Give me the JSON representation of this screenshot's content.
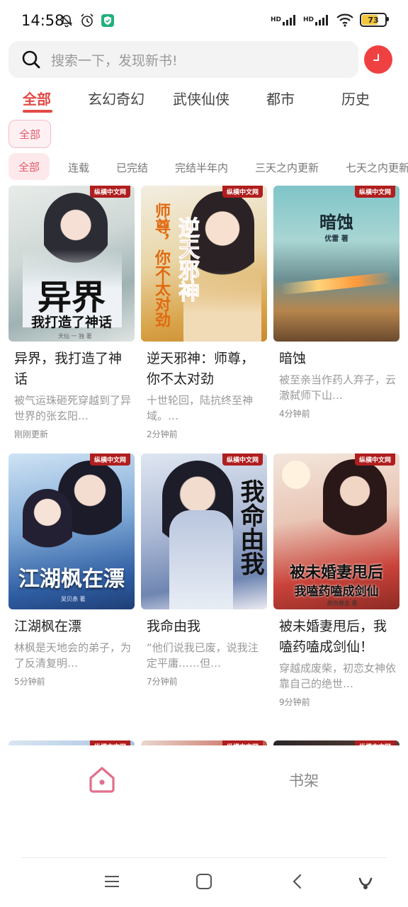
{
  "status_bar": {
    "time": "14:58",
    "battery": "73",
    "hd_label_1": "HD",
    "hd_label_2": "HD"
  },
  "search": {
    "placeholder": "搜索一下，发现新书!"
  },
  "category_tabs": [
    "全部",
    "玄幻奇幻",
    "武侠仙侠",
    "都市",
    "历史"
  ],
  "subcategory_chip": "全部",
  "filter_tabs": [
    "全部",
    "连载",
    "已完结",
    "完结半年内",
    "三天之内更新",
    "七天之内更新"
  ],
  "books": [
    {
      "title": "异界，我打造了神话",
      "desc": "被气运珠砸死穿越到了异世界的张玄阳…",
      "time": "刚刚更新",
      "cover_big": "异界",
      "cover_sub": "我打造了神话",
      "cover_author": "天仙 一 独 著"
    },
    {
      "title": "逆天邪神：师尊，你不太对劲",
      "desc": "十世轮回，陆抗终至神域。…",
      "time": "2分钟前",
      "cover_title_a": "逆天邪神",
      "cover_title_b": "师尊，你不太对劲"
    },
    {
      "title": "暗蚀",
      "desc": "被至亲当作药人弃子，云澈弑师下山…",
      "time": "4分钟前",
      "cover_title": "暗蚀",
      "cover_author": "优雷 著"
    },
    {
      "title": "江湖枫在漂",
      "desc": "林枫是天地会的弟子，为了反清复明…",
      "time": "5分钟前",
      "cover_title": "江湖枫在漂",
      "cover_author": "吴贝赤 著"
    },
    {
      "title": "我命由我",
      "desc": "“他们说我已废，说我注定平庸……但…",
      "time": "7分钟前",
      "cover_title": "我命由我"
    },
    {
      "title": "被未婚妻甩后，我嗑药嗑成剑仙！",
      "desc": "穿越成废柴，初恋女神依靠自己的绝世…",
      "time": "9分钟前",
      "cover_big": "被未婚妻甩后",
      "cover_sub": "我嗑药嗑成剑仙",
      "cover_author": "颜色暴击 著"
    }
  ],
  "publisher_tag": "纵横中文网",
  "bottom_nav": {
    "shelf_label": "书架"
  },
  "colors": {
    "accent": "#e34a45",
    "chip_pink": "#fde9ec",
    "profile_red": "#ef4141"
  },
  "icons": [
    "search-icon",
    "bell-off-icon",
    "alarm-icon",
    "shield-icon",
    "signal-icon",
    "wifi-icon",
    "battery-icon",
    "home-icon",
    "menu-icon",
    "square-icon",
    "back-icon",
    "assistant-icon"
  ]
}
